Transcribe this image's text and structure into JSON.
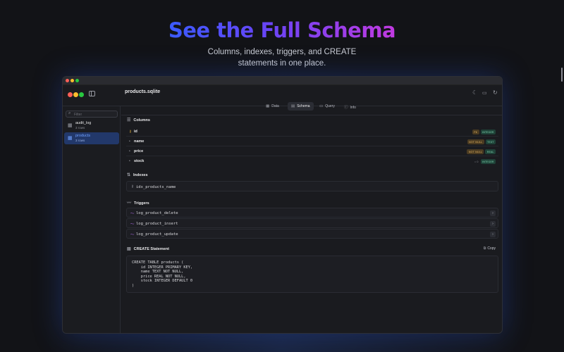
{
  "hero": {
    "title": "See the Full Schema",
    "subtitle_line1": "Columns, indexes, triggers, and CREATE",
    "subtitle_line2": "statements in one place."
  },
  "window": {
    "title": "products.sqlite"
  },
  "sidebar": {
    "filter_placeholder": "Filter",
    "items": [
      {
        "name": "audit_log",
        "rows": "3 rows",
        "active": false
      },
      {
        "name": "products",
        "rows": "3 rows",
        "active": true
      }
    ]
  },
  "tabs": [
    {
      "label": "Data",
      "icon": "grid-icon",
      "active": false
    },
    {
      "label": "Schema",
      "icon": "table-icon",
      "active": true
    },
    {
      "label": "Query",
      "icon": "terminal-icon",
      "active": false
    },
    {
      "label": "Info",
      "icon": "info-icon",
      "active": false
    }
  ],
  "columns": {
    "heading": "Columns",
    "rows": [
      {
        "name": "id",
        "primary_key": true,
        "badges": [
          "PK",
          "INTEGER"
        ]
      },
      {
        "name": "name",
        "primary_key": false,
        "badges": [
          "NOT NULL",
          "TEXT"
        ]
      },
      {
        "name": "price",
        "primary_key": false,
        "badges": [
          "NOT NULL",
          "REAL"
        ]
      },
      {
        "name": "stock",
        "primary_key": false,
        "default_marker": "= 0",
        "badges": [
          "INTEGER"
        ]
      }
    ]
  },
  "indexes": {
    "heading": "Indexes",
    "items": [
      "idx_products_name"
    ]
  },
  "triggers": {
    "heading": "Triggers",
    "items": [
      "log_product_delete",
      "log_product_insert",
      "log_product_update"
    ]
  },
  "create": {
    "heading": "CREATE Statement",
    "copy_label": "Copy",
    "sql": "CREATE TABLE products (\n    id INTEGER PRIMARY KEY,\n    name TEXT NOT NULL,\n    price REAL NOT NULL,\n    stock INTEGER DEFAULT 0\n)"
  },
  "colors": {
    "accent": "#3b82f6",
    "pk": "#e0b03a",
    "trigger": "#b46ef0",
    "type_badge": "#7fd3b0"
  }
}
